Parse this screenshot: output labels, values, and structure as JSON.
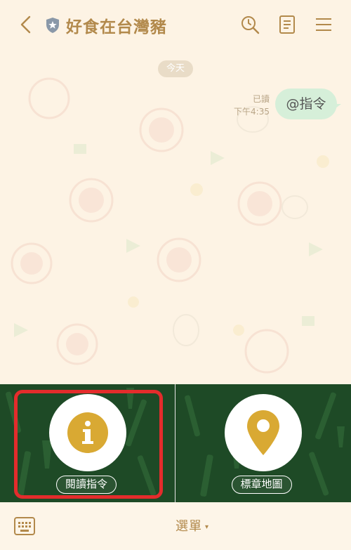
{
  "header": {
    "title": "好食在台灣豬",
    "icons": [
      "back-arrow-icon",
      "official-shield-icon",
      "search-history-icon",
      "notes-icon",
      "menu-hamburger-icon"
    ]
  },
  "chat": {
    "date_badge": "今天",
    "messages": [
      {
        "sender": "me",
        "text": "@指令",
        "read_status": "已讀",
        "time": "下午4:35"
      }
    ]
  },
  "rich_menu": {
    "background_color": "#1e4a26",
    "items": [
      {
        "label": "閱讀指令",
        "icon": "info-icon",
        "icon_color": "#d9a933"
      },
      {
        "label": "標章地圖",
        "icon": "map-pin-icon",
        "icon_color": "#d9a933"
      }
    ],
    "highlight_color": "#e42c2c"
  },
  "bottom_bar": {
    "keyboard_icon": "keyboard-icon",
    "menu_label": "選單",
    "caret": "▾"
  }
}
